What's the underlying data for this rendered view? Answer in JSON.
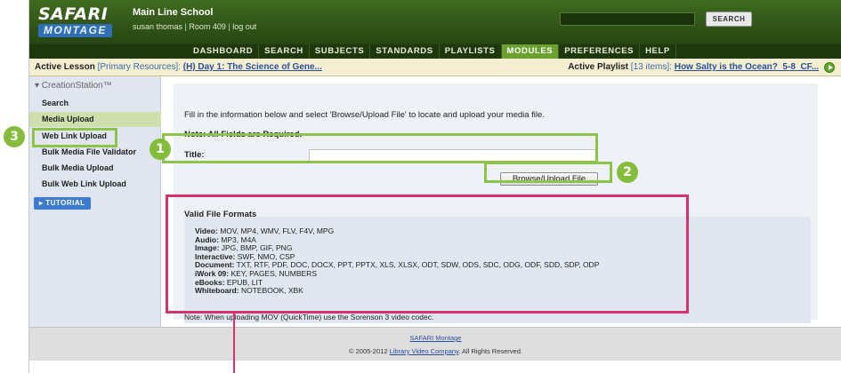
{
  "header": {
    "logo_top": "SAFARI",
    "logo_bottom": "MONTAGE",
    "school": "Main Line School",
    "user": "susan thomas",
    "room": "Room 409",
    "logout": "log out",
    "search_label": "SEARCH"
  },
  "nav": {
    "items": [
      "DASHBOARD",
      "SEARCH",
      "SUBJECTS",
      "STANDARDS",
      "PLAYLISTS",
      "MODULES",
      "PREFERENCES",
      "HELP"
    ],
    "active": "MODULES"
  },
  "lesson_bar": {
    "lesson_label": "Active Lesson",
    "lesson_resources": "[Primary Resources]:",
    "lesson_link": "(H) Day 1: The Science of Gene...",
    "playlist_label": "Active Playlist",
    "playlist_count": "[13 items]:",
    "playlist_link": "How Salty is the Ocean?_5-8_CF..."
  },
  "sidebar": {
    "title": "▾ CreationStation™",
    "items": [
      "Search",
      "Media Upload",
      "Web Link Upload",
      "Bulk Media File Validator",
      "Bulk Media Upload",
      "Bulk Web Link Upload"
    ],
    "selected": "Media Upload",
    "tutorial": "▸ TUTORIAL"
  },
  "form": {
    "instructions": "Fill in the information below and select 'Browse/Upload File' to locate and upload your media file.",
    "note": "Note: All Fields are Required.",
    "title_label": "Title:",
    "title_value": "",
    "browse_button": "Browse/Upload File"
  },
  "formats": {
    "heading": "Valid File Formats",
    "rows": [
      {
        "label": "Video:",
        "value": " MOV, MP4, WMV, FLV, F4V, MPG"
      },
      {
        "label": "Audio:",
        "value": " MP3, M4A"
      },
      {
        "label": "Image:",
        "value": " JPG, BMP, GIF, PNG"
      },
      {
        "label": "Interactive:",
        "value": " SWF, NMO, CSP"
      },
      {
        "label": "Document:",
        "value": " TXT, RTF, PDF, DOC, DOCX, PPT, PPTX, XLS, XLSX, ODT, SDW, ODS, SDC, ODG, ODF, SDD, SDP, ODP"
      },
      {
        "label": "iWork 09:",
        "value": " KEY, PAGES, NUMBERS"
      },
      {
        "label": "eBooks:",
        "value": " EPUB, LIT"
      },
      {
        "label": "Whiteboard:",
        "value": " NOTEBOOK, XBK"
      }
    ],
    "note": "Note: When uploading MOV (QuickTime) use the Sorenson 3 video codec."
  },
  "footer": {
    "link": "SAFARI Montage",
    "copyright_prefix": "© 2005-2012 ",
    "company": "Library Video Company",
    "copyright_suffix": ". All Rights Reserved."
  },
  "callouts": [
    "1",
    "2",
    "3"
  ],
  "colors": {
    "header_green": "#3f6a1f",
    "nav_active": "#6aa12f",
    "callout_green": "#86bc3b",
    "highlight_pink": "#d6336e",
    "link_blue": "#2b4f9b"
  }
}
